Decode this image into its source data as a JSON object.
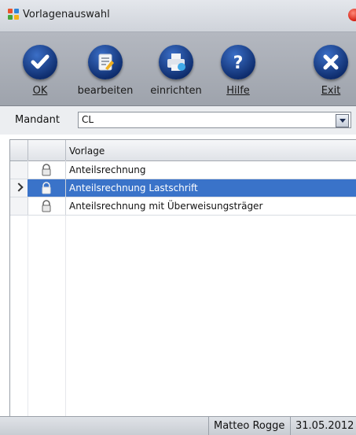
{
  "window": {
    "title": "Vorlagenauswahl"
  },
  "toolbar": {
    "ok": "OK",
    "bearbeiten": "bearbeiten",
    "einrichten": "einrichten",
    "hilfe": "Hilfe",
    "exit": "Exit"
  },
  "mandant": {
    "label": "Mandant",
    "value": "CL"
  },
  "grid": {
    "column_header": "Vorlage",
    "rows": [
      {
        "name": "Anteilsrechnung",
        "selected": false
      },
      {
        "name": "Anteilsrechnung Lastschrift",
        "selected": true
      },
      {
        "name": "Anteilsrechnung mit Überweisungsträger",
        "selected": false
      }
    ]
  },
  "status": {
    "user": "Matteo Rogge",
    "date": "31.05.2012"
  },
  "colors": {
    "selection": "#3a73c9",
    "toolbar": "#a9adb5",
    "icon": "#1a3f8c"
  },
  "icons": [
    "check-icon",
    "edit-document-icon",
    "printer-icon",
    "help-icon",
    "exit-x-icon",
    "lock-icon",
    "app-grid-icon"
  ]
}
